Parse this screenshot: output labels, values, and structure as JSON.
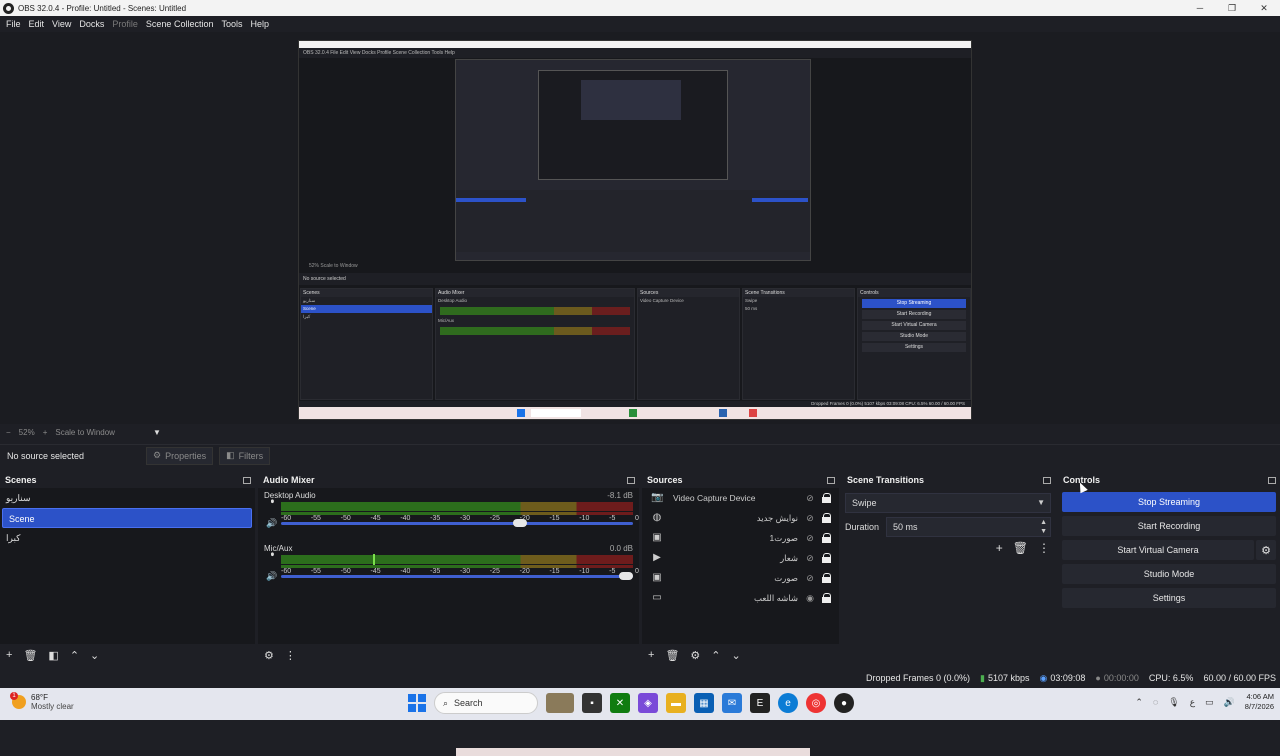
{
  "window": {
    "title": "OBS 32.0.4 - Profile: Untitled - Scenes: Untitled",
    "minimize": "─",
    "maximize": "❐",
    "close": "✕"
  },
  "menu": [
    "File",
    "Edit",
    "View",
    "Docks",
    "Profile",
    "Scene Collection",
    "Tools",
    "Help"
  ],
  "preview": {
    "nested_menu": "OBS 32.0.4   File  Edit  View  Docks  Profile  Scene Collection  Tools  Help",
    "nested_zoom": "52%  Scale to Window",
    "nested_no_source": "No source selected",
    "nested_status": "Dropped Frames 0 (0.0%)  5107 kbps  03:09:08  CPU: 6.5%  60.00 / 60.00 FPS"
  },
  "zoom": {
    "minus": "−",
    "level": "52%",
    "plus": "+",
    "mode": "Scale to Window",
    "arrow": "▼"
  },
  "source_bar": {
    "no_source": "No source selected",
    "properties": "Properties",
    "filters": "Filters"
  },
  "scenes": {
    "title": "Scenes",
    "items": [
      "سناریو",
      "Scene",
      "کبرا"
    ],
    "active_index": 1
  },
  "mixer": {
    "title": "Audio Mixer",
    "ticks": [
      "-60",
      "-55",
      "-50",
      "-45",
      "-40",
      "-35",
      "-30",
      "-25",
      "-20",
      "-15",
      "-10",
      "-5",
      "0"
    ],
    "channels": [
      {
        "name": "Desktop Audio",
        "db": "-8.1 dB",
        "volume": 0.68,
        "peak": null
      },
      {
        "name": "Mic/Aux",
        "db": "0.0 dB",
        "volume": 0.98,
        "peak": 0.26
      }
    ]
  },
  "sources": {
    "title": "Sources",
    "items": [
      {
        "name": "Video Capture Device",
        "icon": "camera-icon",
        "visible": false,
        "rtl": false
      },
      {
        "name": "نوایش جدید",
        "icon": "globe-icon",
        "visible": false,
        "rtl": true
      },
      {
        "name": "صورت1",
        "icon": "image-icon",
        "visible": false,
        "rtl": true
      },
      {
        "name": "شعار",
        "icon": "play-icon",
        "visible": false,
        "rtl": true
      },
      {
        "name": "صورت",
        "icon": "image-icon",
        "visible": false,
        "rtl": true
      },
      {
        "name": "شاشه اللعب",
        "icon": "monitor-icon",
        "visible": true,
        "rtl": true
      }
    ]
  },
  "transitions": {
    "title": "Scene Transitions",
    "selected": "Swipe",
    "duration_label": "Duration",
    "duration_value": "50 ms"
  },
  "controls": {
    "title": "Controls",
    "stop_streaming": "Stop Streaming",
    "start_recording": "Start Recording",
    "start_virtual_camera": "Start Virtual Camera",
    "studio_mode": "Studio Mode",
    "settings": "Settings"
  },
  "status": {
    "dropped_frames": "Dropped Frames 0 (0.0%)",
    "bitrate": "5107 kbps",
    "stream_time": "03:09:08",
    "record_time": "00:00:00",
    "cpu": "CPU: 6.5%",
    "fps": "60.00 / 60.00 FPS"
  },
  "taskbar": {
    "weather_badge": "1",
    "temp": "68°F",
    "condition": "Mostly clear",
    "search": "Search",
    "time": "4:06 AM",
    "date": "8/7/2026"
  },
  "colors": {
    "accent": "#2c52c8",
    "panel": "#1e1f25",
    "dock_bg": "#17181c"
  }
}
